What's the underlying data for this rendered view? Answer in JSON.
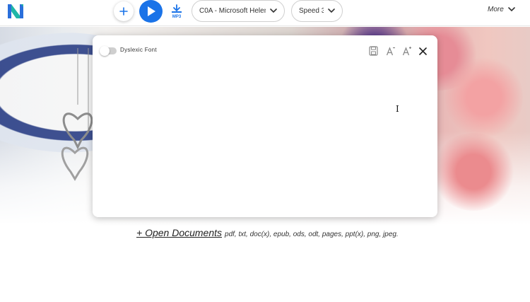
{
  "toolbar": {
    "voice_label": "C0A - Microsoft Helena…",
    "speed_label": "Speed 3",
    "more_label": "More",
    "mp3_icon_text": "MP3"
  },
  "panel": {
    "dyslexic_font_label": "Dyslexic Font",
    "dyslexic_font_enabled": false,
    "editor_text": ""
  },
  "upload": {
    "link_label": "+ Open Documents",
    "formats_text": "pdf, txt, doc(x), epub, ods, odt, pages, ppt(x), png, jpeg."
  },
  "colors": {
    "accent": "#1a73e8",
    "logo_teal": "#1fb6a6",
    "logo_blue": "#2a6fdb"
  },
  "icons": {
    "logo": "naturalreader-logo",
    "add": "plus-icon",
    "play": "play-icon",
    "mp3": "mp3-download-icon",
    "dropdown": "chevron-down-icon",
    "save": "save-icon",
    "font_minus": "font-decrease-icon",
    "font_plus": "font-increase-icon",
    "close": "close-icon"
  }
}
